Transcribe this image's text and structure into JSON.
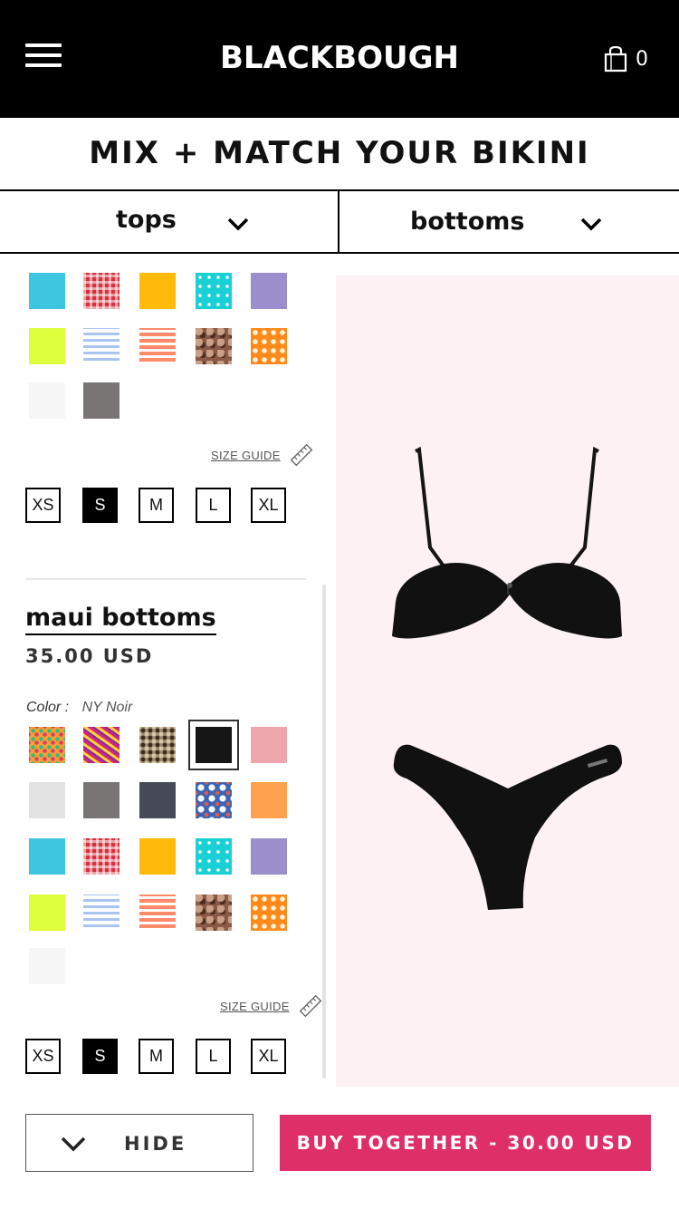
{
  "header": {
    "brand": "BLACKBOUGH",
    "cart_count": "0"
  },
  "page_title": "MIX + MATCH YOUR BIKINI",
  "tabs": {
    "tops": "tops",
    "bottoms": "bottoms"
  },
  "tops_panel": {
    "swatches": [
      {
        "name": "sky-blue",
        "color": "#3ec6e0"
      },
      {
        "name": "red-gingham",
        "color": "#d8303c"
      },
      {
        "name": "golden-yellow",
        "color": "#ffba0a"
      },
      {
        "name": "aqua-polka",
        "color": "#19d0d6"
      },
      {
        "name": "lavender",
        "color": "#9b8ecc"
      },
      {
        "name": "neon-lime",
        "color": "#ddff3c"
      },
      {
        "name": "blue-stripe",
        "color": "#a9c4f0"
      },
      {
        "name": "coral-stripe",
        "color": "#ff8a6a"
      },
      {
        "name": "snake-print",
        "color": "#8a5a46"
      },
      {
        "name": "orange-geo",
        "color": "#ff8a1c"
      },
      {
        "name": "white",
        "color": "#f6f6f6"
      },
      {
        "name": "grey",
        "color": "#7a7575"
      }
    ],
    "size_guide": "SIZE GUIDE",
    "sizes": [
      "XS",
      "S",
      "M",
      "L",
      "XL"
    ],
    "selected_size": "S"
  },
  "bottoms_panel": {
    "name": "maui bottoms",
    "price": "35.00 USD",
    "color_label": "Color :",
    "color_value": "NY Noir",
    "swatches": [
      {
        "name": "floral-multi",
        "color": "#f1a040"
      },
      {
        "name": "zebra-pink",
        "color": "#d0287c"
      },
      {
        "name": "leopard",
        "color": "#9a8a70"
      },
      {
        "name": "ny-noir",
        "color": "#161616"
      },
      {
        "name": "blush-pink",
        "color": "#eea6ad"
      },
      {
        "name": "light-grey",
        "color": "#e3e3e3"
      },
      {
        "name": "grey",
        "color": "#7a7575"
      },
      {
        "name": "charcoal",
        "color": "#474b57"
      },
      {
        "name": "tropical-leaf",
        "color": "#3c64b4"
      },
      {
        "name": "orange",
        "color": "#ffa14e"
      },
      {
        "name": "sky-blue",
        "color": "#3ec6e0"
      },
      {
        "name": "red-gingham",
        "color": "#d8303c"
      },
      {
        "name": "golden-yellow",
        "color": "#ffba0a"
      },
      {
        "name": "aqua-polka",
        "color": "#19d0d6"
      },
      {
        "name": "lavender",
        "color": "#9b8ecc"
      },
      {
        "name": "neon-lime",
        "color": "#ddff3c"
      },
      {
        "name": "blue-stripe",
        "color": "#a9c4f0"
      },
      {
        "name": "coral-stripe",
        "color": "#ff8a6a"
      },
      {
        "name": "snake-print",
        "color": "#8a5a46"
      },
      {
        "name": "orange-geo",
        "color": "#ff8a1c"
      },
      {
        "name": "white",
        "color": "#f6f6f6"
      }
    ],
    "selected_swatch": "ny-noir",
    "size_guide": "SIZE GUIDE",
    "sizes": [
      "XS",
      "S",
      "M",
      "L",
      "XL"
    ],
    "selected_size": "S"
  },
  "preview": {
    "background": "#fdf1f4",
    "top_color": "#111111",
    "bottom_color": "#111111"
  },
  "actions": {
    "hide": "HIDE",
    "buy": "BUY TOGETHER - 30.00 USD",
    "buy_color": "#df2f69"
  }
}
